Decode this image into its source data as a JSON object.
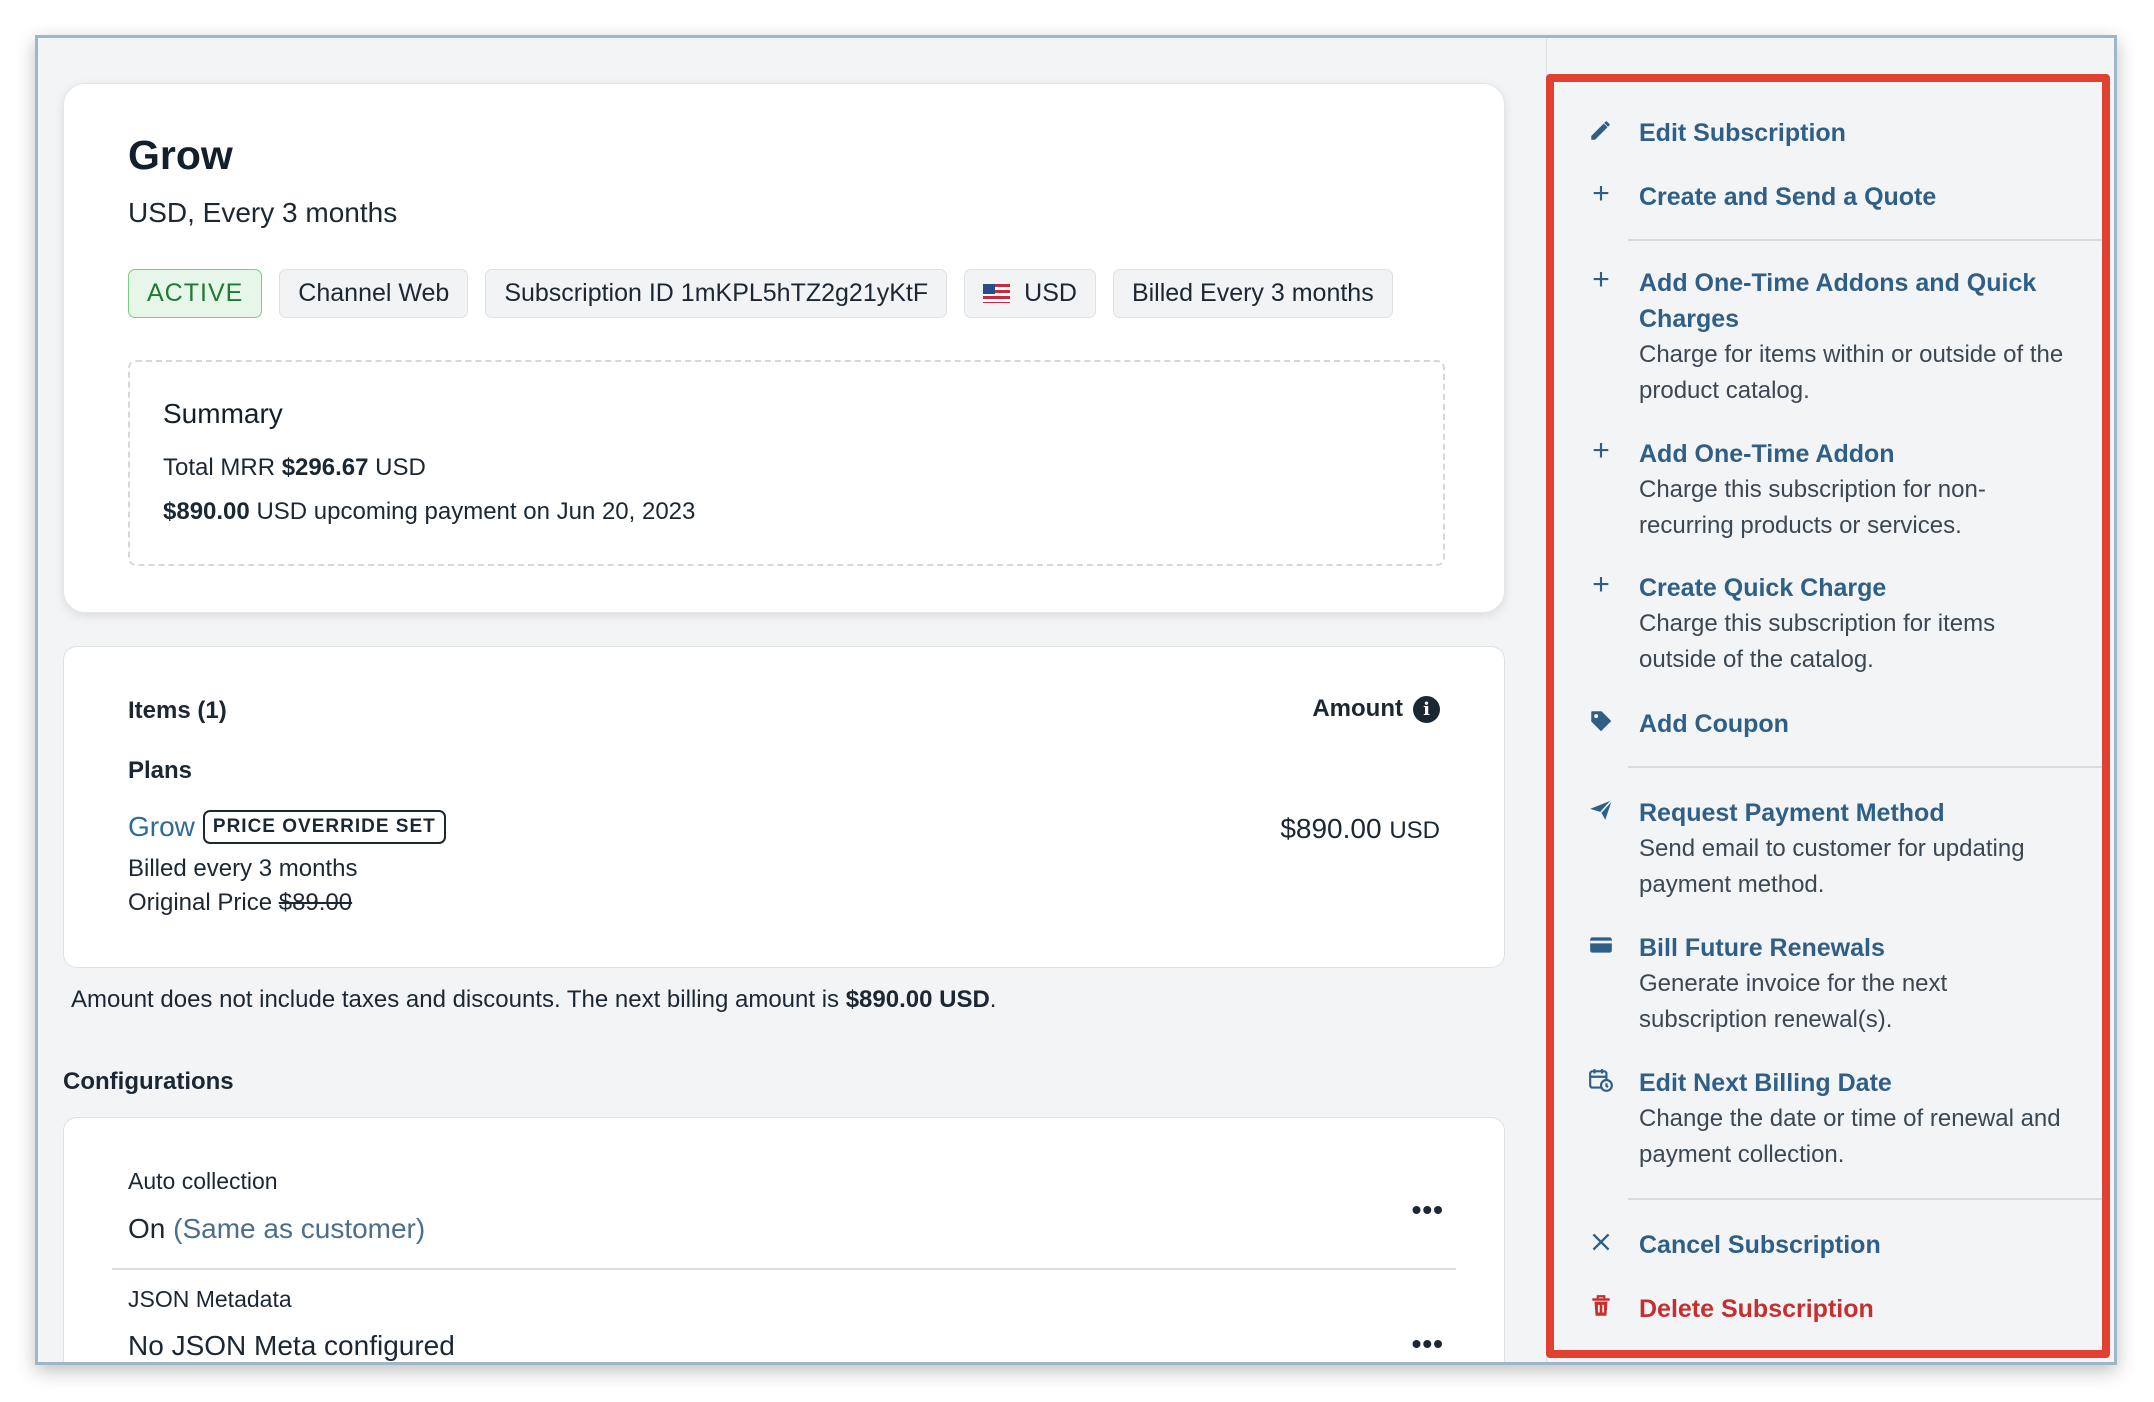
{
  "plan": {
    "name": "Grow",
    "subtitle": "USD, Every 3 months",
    "tags": {
      "status": "ACTIVE",
      "channel": "Channel Web",
      "subscription_id": "Subscription ID 1mKPL5hTZ2g21yKtF",
      "currency": "USD",
      "billing": "Billed Every 3 months"
    }
  },
  "summary": {
    "title": "Summary",
    "mrr_label": "Total MRR",
    "mrr_value": "$296.67",
    "mrr_currency": "USD",
    "upcoming_value": "$890.00",
    "upcoming_text": "USD upcoming payment on Jun 20, 2023"
  },
  "items": {
    "title": "Items (1)",
    "amount_header": "Amount",
    "info_glyph": "i",
    "plans_label": "Plans",
    "item_name": "Grow",
    "override_badge": "PRICE OVERRIDE SET",
    "price": "$890.00",
    "price_currency": "USD",
    "billed": "Billed every 3 months",
    "original_label": "Original Price",
    "original_price": "$89.00"
  },
  "note": {
    "text": "Amount does not include taxes and discounts. The next billing amount is",
    "amount": "$890.00 USD",
    "end": "."
  },
  "configurations": {
    "title": "Configurations",
    "auto_label": "Auto collection",
    "auto_value": "On",
    "auto_hint": "(Same as customer)",
    "json_label": "JSON Metadata",
    "json_value": "No JSON Meta configured",
    "more_glyph": "•••"
  },
  "actions": {
    "edit": {
      "label": "Edit Subscription",
      "icon": "pencil-icon"
    },
    "quote": {
      "label": "Create and Send a Quote",
      "icon": "plus-icon"
    },
    "addons_quick": {
      "label_1": "Add One-Time Addons and Quick",
      "label_2": "Charges",
      "desc_1": "Charge for items within or outside of the",
      "desc_2": "product catalog.",
      "icon": "plus-icon"
    },
    "addon": {
      "label": "Add One-Time Addon",
      "desc_1": "Charge this subscription for non-",
      "desc_2": "recurring products or services.",
      "icon": "plus-icon"
    },
    "quick": {
      "label": "Create Quick Charge",
      "desc_1": "Charge this subscription for items",
      "desc_2": "outside of the catalog.",
      "icon": "plus-icon"
    },
    "coupon": {
      "label": "Add Coupon",
      "icon": "tag-icon"
    },
    "request_payment": {
      "label": "Request Payment Method",
      "desc_1": "Send email to customer for updating",
      "desc_2": "payment method.",
      "icon": "send-icon"
    },
    "bill_future": {
      "label": "Bill Future Renewals",
      "desc_1": "Generate invoice for the next",
      "desc_2": "subscription renewal(s).",
      "icon": "card-icon"
    },
    "next_billing": {
      "label": "Edit Next Billing Date",
      "desc_1": "Change the date or time of renewal and",
      "desc_2": "payment collection.",
      "icon": "calendar-clock-icon"
    },
    "cancel": {
      "label": "Cancel Subscription",
      "icon": "x-icon"
    },
    "delete": {
      "label": "Delete Subscription",
      "icon": "trash-icon"
    }
  },
  "colors": {
    "link": "#2f5f86",
    "danger": "#c62f2f",
    "active_green": "#1f7a35",
    "highlight_border": "#e0402f"
  }
}
